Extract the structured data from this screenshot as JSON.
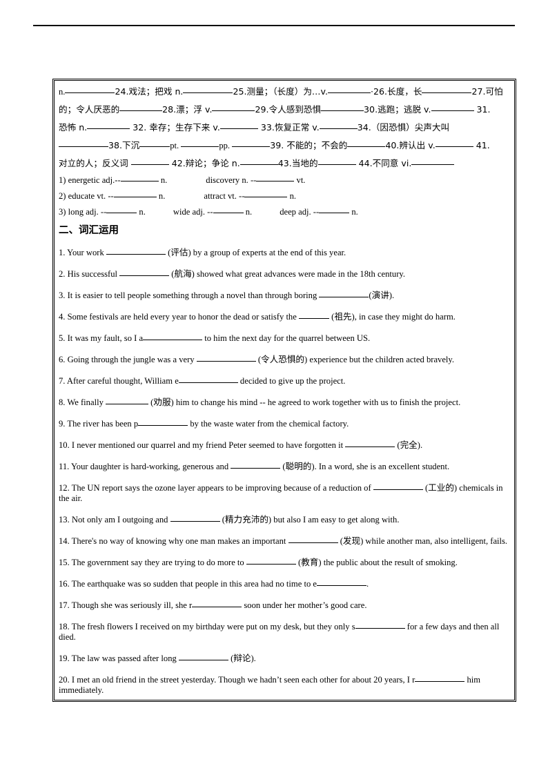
{
  "page": {
    "header_rule": true
  },
  "vocab_list": {
    "lines": [
      {
        "id": "line-24-27",
        "segments": [
          {
            "t": "n.",
            "type": "text"
          },
          {
            "t": "",
            "type": "blank",
            "w": "xl"
          },
          {
            "t": "24.戏法；把戏 n.",
            "type": "cn"
          },
          {
            "t": "",
            "type": "blank",
            "w": "xl"
          },
          {
            "t": "25.测量；（长度）为…v.",
            "type": "cn"
          },
          {
            "t": "",
            "type": "blank",
            "w": "l"
          },
          {
            "t": "·26.长度，长",
            "type": "cn"
          },
          {
            "t": "",
            "type": "blank",
            "w": "xl"
          },
          {
            "t": "27.可怕",
            "type": "cn"
          }
        ]
      },
      {
        "id": "line-28-31",
        "segments": [
          {
            "t": "的；令人厌恶的",
            "type": "cn"
          },
          {
            "t": "",
            "type": "blank",
            "w": "l"
          },
          {
            "t": "28.漂；浮 v.",
            "type": "cn"
          },
          {
            "t": "",
            "type": "blank",
            "w": "l"
          },
          {
            "t": "29.令人感到恐惧",
            "type": "cn"
          },
          {
            "t": "",
            "type": "blank",
            "w": "l"
          },
          {
            "t": "30.逃跑；逃脱 v.",
            "type": "cn"
          },
          {
            "t": "",
            "type": "blank",
            "w": "l"
          },
          {
            "t": " 31.",
            "type": "cn"
          }
        ]
      },
      {
        "id": "line-32-34",
        "segments": [
          {
            "t": "恐怖 n.",
            "type": "cn"
          },
          {
            "t": "",
            "type": "blank",
            "w": "l"
          },
          {
            "t": " 32. 幸存；生存下来 v.",
            "type": "cn"
          },
          {
            "t": "",
            "type": "blank",
            "w": "m"
          },
          {
            "t": " 33.恢复正常 v.",
            "type": "cn"
          },
          {
            "t": "",
            "type": "blank",
            "w": "m"
          },
          {
            "t": "34.（因恐惧）尖声大叫",
            "type": "cn"
          }
        ]
      },
      {
        "id": "line-38-41",
        "segments": [
          {
            "t": "",
            "type": "blank",
            "w": "xl"
          },
          {
            "t": "38.下沉",
            "type": "cn"
          },
          {
            "t": "",
            "type": "blank",
            "w": "s"
          },
          {
            "t": "pt. ",
            "type": "text"
          },
          {
            "t": "",
            "type": "blank",
            "w": "m"
          },
          {
            "t": "pp. ",
            "type": "text"
          },
          {
            "t": "",
            "type": "blank",
            "w": "m"
          },
          {
            "t": "39. 不能的；不会的",
            "type": "cn"
          },
          {
            "t": "",
            "type": "blank",
            "w": "m"
          },
          {
            "t": "40.辨认出 v.",
            "type": "cn"
          },
          {
            "t": "",
            "type": "blank",
            "w": "m"
          },
          {
            "t": " 41.",
            "type": "cn"
          }
        ]
      },
      {
        "id": "line-42-44",
        "segments": [
          {
            "t": "对立的人；反义词 ",
            "type": "cn"
          },
          {
            "t": "",
            "type": "blank",
            "w": "m"
          },
          {
            "t": " 42.辩论；争论 n.",
            "type": "cn"
          },
          {
            "t": "",
            "type": "blank",
            "w": "m"
          },
          {
            "t": "43.当地的",
            "type": "cn"
          },
          {
            "t": "",
            "type": "blank",
            "w": "m"
          },
          {
            "t": " 44.不同意 vi.",
            "type": "cn"
          },
          {
            "t": "",
            "type": "blank",
            "w": "l"
          }
        ]
      }
    ]
  },
  "derivations": [
    {
      "id": "deriv-1",
      "number": "1)",
      "pairs": [
        {
          "word": "energetic adj.--",
          "blank": "m",
          "pos": "n."
        },
        {
          "word": "discovery n. --",
          "blank": "m",
          "pos": "vt."
        }
      ]
    },
    {
      "id": "deriv-2",
      "number": "2)",
      "pairs": [
        {
          "word": "educate vt. --",
          "blank": "l",
          "pos": "n."
        },
        {
          "word": "attract vt. --",
          "blank": "l",
          "pos": "n."
        }
      ]
    },
    {
      "id": "deriv-3",
      "number": "3)",
      "pairs": [
        {
          "word": "long adj. --",
          "blank": "s",
          "pos": "n."
        },
        {
          "word": "wide adj. --",
          "blank": "s",
          "pos": "n."
        },
        {
          "word": "deep adj. --",
          "blank": "s",
          "pos": "n."
        }
      ]
    }
  ],
  "section": {
    "heading": "二、词汇运用"
  },
  "exercises": [
    {
      "id": "ex-1",
      "number": "1.",
      "pre": " Your work ",
      "blank": "xxl",
      "post": " (评估) by a group of experts at the end of this year."
    },
    {
      "id": "ex-2",
      "number": "2.",
      "pre": " His successful ",
      "blank": "xl",
      "post": " (航海) showed what great advances were made in the 18th century."
    },
    {
      "id": "ex-3",
      "number": "3.",
      "pre": " It is easier to tell people something through a novel than through boring ",
      "blank": "xl",
      "post": "(演讲)."
    },
    {
      "id": "ex-4",
      "number": "4.",
      "pre": " Some festivals are held every year to honor the dead or satisfy the ",
      "blank": "s",
      "post": " (祖先), in case they might do harm."
    },
    {
      "id": "ex-5",
      "number": "5.",
      "pre": " It was my fault, so I a",
      "blank": "xxl",
      "post": " to him the next day for the quarrel between US."
    },
    {
      "id": "ex-6",
      "number": "6.",
      "pre": " Going through the jungle was a very ",
      "blank": "xxl",
      "post": " (令人恐惧的) experience but the children acted bravely."
    },
    {
      "id": "ex-7",
      "number": "7.",
      "pre": " After careful thought, William e",
      "blank": "xxl",
      "post": " decided to give up the project."
    },
    {
      "id": "ex-8",
      "number": "8.",
      "pre": " We finally ",
      "blank": "l",
      "post": " (劝服) him to change his mind -- he agreed to work together with us to finish the project."
    },
    {
      "id": "ex-9",
      "number": "9.",
      "pre": " The river has been p",
      "blank": "xl",
      "post": " by the waste water from the chemical factory."
    },
    {
      "id": "ex-10",
      "number": "10.",
      "pre": " I never mentioned our quarrel and my friend Peter seemed to have forgotten it ",
      "blank": "xl",
      "post": " (完全)."
    },
    {
      "id": "ex-11",
      "number": "11.",
      "pre": " Your daughter is hard-working, generous and ",
      "blank": "xl",
      "post": " (聪明的). In a word, she is an excellent student."
    },
    {
      "id": "ex-12",
      "number": "12.",
      "pre": " The UN report says the ozone layer appears to be improving because of a reduction of ",
      "blank": "xl",
      "post": " (工业的) chemicals in the air."
    },
    {
      "id": "ex-13",
      "number": "13.",
      "pre": " Not only am I outgoing and ",
      "blank": "xl",
      "post": " (精力充沛的) but also I am easy to get along with."
    },
    {
      "id": "ex-14",
      "number": "14.",
      "pre": " There's no way of knowing why one man makes an important ",
      "blank": "xl",
      "post": " (发现) while another man, also intelligent, fails."
    },
    {
      "id": "ex-15",
      "number": "15.",
      "pre": " The government say they are trying to do more to ",
      "blank": "xl",
      "post": " (教育) the public about the result of smoking."
    },
    {
      "id": "ex-16",
      "number": "16.",
      "pre": " The earthquake was so sudden that people in this area had no time to e",
      "blank": "xl",
      "post": "."
    },
    {
      "id": "ex-17",
      "number": "17.",
      "pre": " Though she was seriously ill, she r",
      "blank": "xl",
      "post": " soon under her mother’s good care."
    },
    {
      "id": "ex-18",
      "number": "18.",
      "pre": " The fresh flowers I received on my birthday were put on my desk, but they only s",
      "blank": "xl",
      "post": " for a few days and then all died."
    },
    {
      "id": "ex-19",
      "number": "19.",
      "pre": " The law was passed after long ",
      "blank": "xl",
      "post": " (辩论)."
    },
    {
      "id": "ex-20",
      "number": "20.",
      "pre": " I met an old friend in the street yesterday. Though we hadn’t seen each other for about 20 years, I r",
      "blank": "xl",
      "post": " him immediately."
    }
  ]
}
